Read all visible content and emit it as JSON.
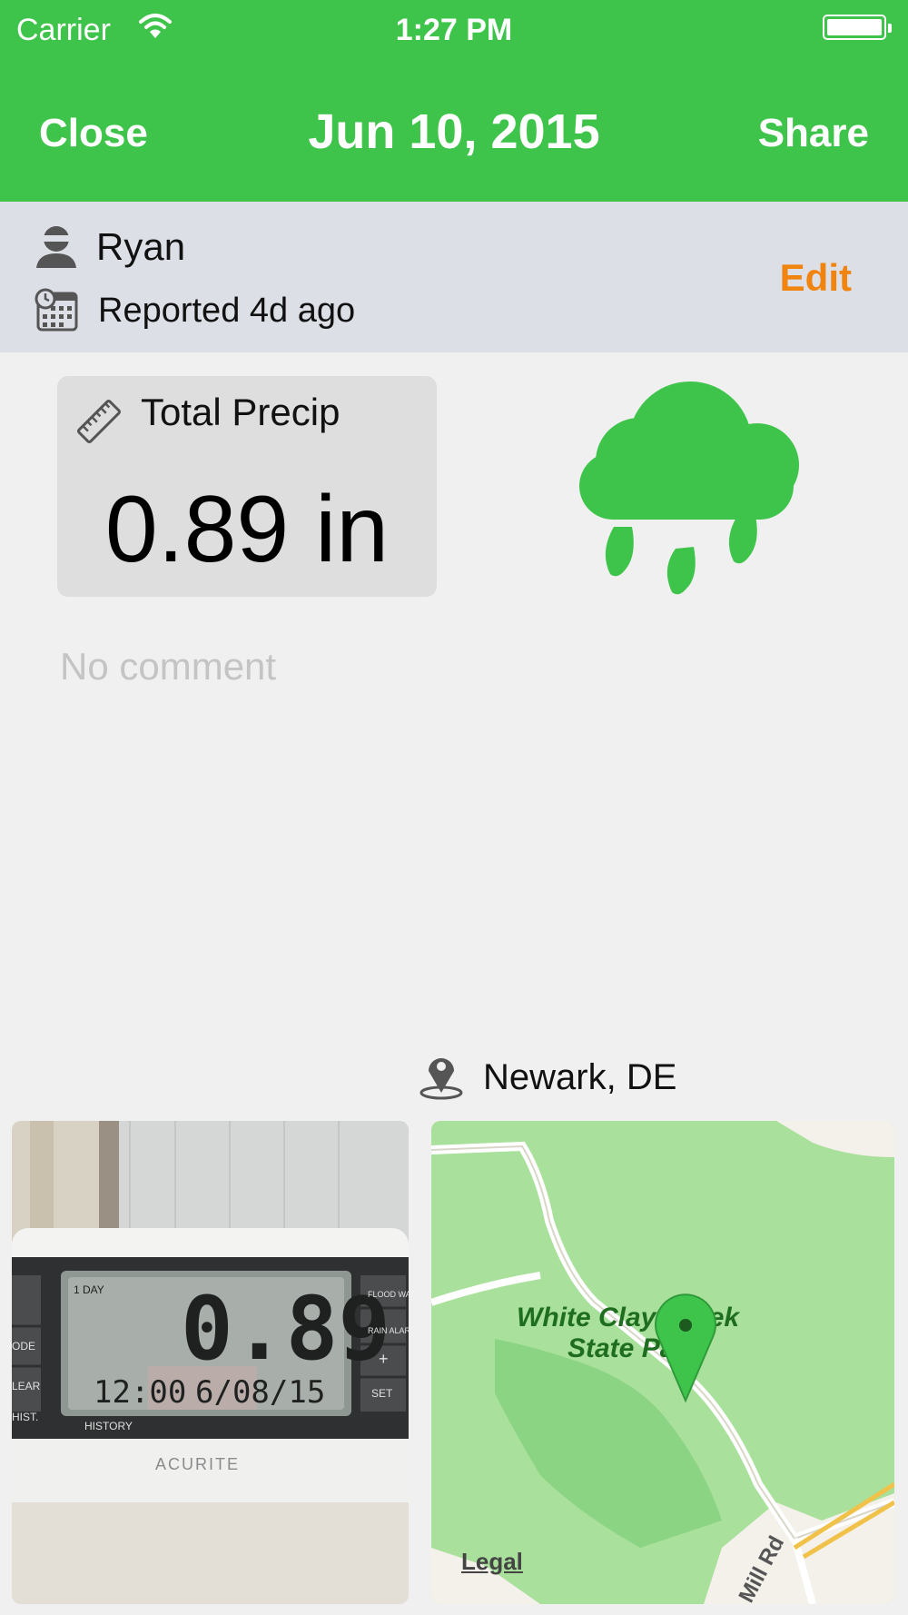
{
  "status_bar": {
    "carrier": "Carrier",
    "time": "1:27 PM"
  },
  "nav": {
    "left_label": "Close",
    "title": "Jun 10, 2015",
    "right_label": "Share"
  },
  "reporter": {
    "name": "Ryan",
    "reported": "Reported 4d ago",
    "edit_label": "Edit"
  },
  "precip": {
    "label": "Total Precip",
    "value": "0.89 in",
    "weather_icon": "rain-cloud-icon",
    "accent": "#3fc44b"
  },
  "comment": "No comment",
  "location": {
    "label": "Newark, DE"
  },
  "photo": {
    "brand": "ACURITE",
    "readout": "0.89",
    "time": "12:00",
    "date": "6/08/15",
    "tag_1day": "1 DAY",
    "tag_history": "HISTORY",
    "btn_flood": "FLOOD WATCH",
    "btn_rain": "RAIN ALARM",
    "btn_plus": "+",
    "btn_set": "SET",
    "btn_mode": "ODE",
    "btn_clear": "LEAR",
    "btn_hist": "HIST."
  },
  "map": {
    "park_line1": "White Clay Creek",
    "park_line2": "State Park",
    "road": "Mill Rd",
    "legal": "Legal"
  },
  "colors": {
    "header": "#3fc44b",
    "edit": "#f0840f",
    "reporter_bg": "#dcdfe6"
  }
}
